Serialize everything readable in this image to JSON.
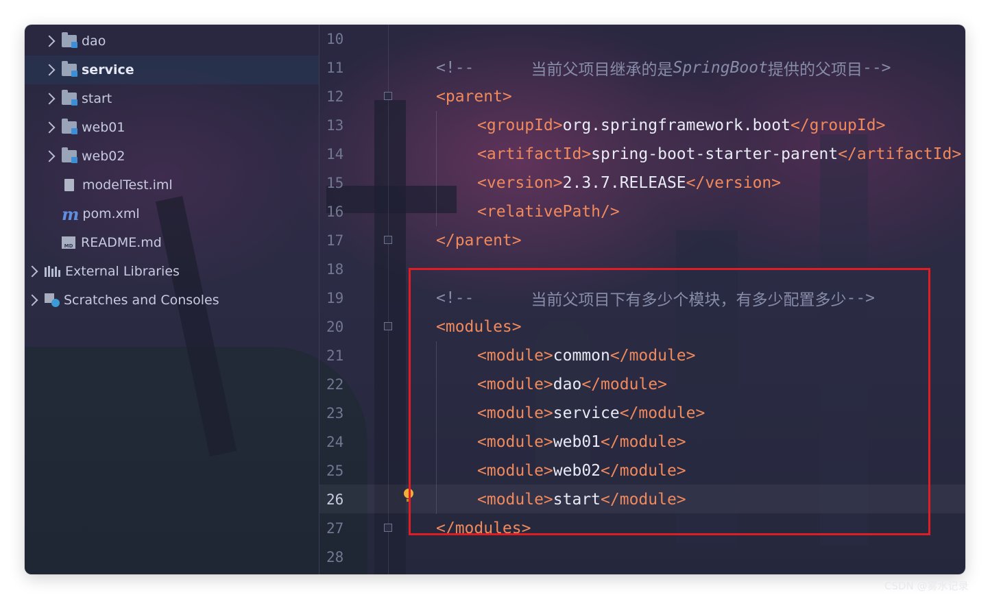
{
  "project_tree": {
    "items": [
      {
        "label": "dao",
        "type": "module-folder"
      },
      {
        "label": "service",
        "type": "module-folder",
        "selected": true
      },
      {
        "label": "start",
        "type": "module-folder"
      },
      {
        "label": "web01",
        "type": "module-folder"
      },
      {
        "label": "web02",
        "type": "module-folder"
      },
      {
        "label": "modelTest.iml",
        "type": "iml-file"
      },
      {
        "label": "pom.xml",
        "type": "maven-file"
      },
      {
        "label": "README.md",
        "type": "markdown-file"
      },
      {
        "label": "External Libraries",
        "type": "libraries"
      },
      {
        "label": "Scratches and Consoles",
        "type": "scratches"
      }
    ]
  },
  "editor": {
    "current_line": 26,
    "line_numbers": [
      "10",
      "11",
      "12",
      "13",
      "14",
      "15",
      "16",
      "17",
      "18",
      "19",
      "20",
      "21",
      "22",
      "23",
      "24",
      "25",
      "26",
      "27",
      "28"
    ],
    "code": {
      "l11": {
        "open": "<!--",
        "text": "      当前父项目继承的是",
        "italic": "SpringBoot",
        "text2": "提供的父项目",
        "close": "-->"
      },
      "l12": "<parent>",
      "l13": {
        "tag_open": "<groupId>",
        "value": "org.springframework.boot",
        "tag_close": "</groupId>"
      },
      "l14": {
        "tag_open": "<artifactId>",
        "value": "spring-boot-starter-parent",
        "tag_close": "</artifactId>"
      },
      "l15": {
        "tag_open": "<version>",
        "value": "2.3.7.RELEASE",
        "tag_close": "</version>"
      },
      "l16": "<relativePath/>",
      "l17": "</parent>",
      "l19": {
        "open": "<!--",
        "text": "      当前父项目下有多少个模块，有多少配置多少",
        "close": "-->"
      },
      "l20": "<modules>",
      "modules": [
        "common",
        "dao",
        "service",
        "web01",
        "web02",
        "start"
      ],
      "module_open": "<module>",
      "module_close": "</module>",
      "l27": "</modules>"
    }
  },
  "highlight_color": "#e11d24",
  "watermark": "CSDN @雾水记录"
}
